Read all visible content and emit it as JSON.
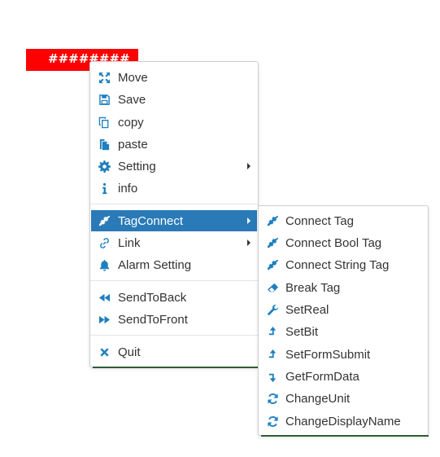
{
  "widget_label": "########",
  "colors": {
    "accent": "#2a7ab8",
    "icon": "#1e7fbf",
    "widget_bg": "#ff0000",
    "underline": "#2e5d34"
  },
  "main_menu": [
    {
      "label": "Move",
      "icon": "arrows-expand-icon"
    },
    {
      "label": "Save",
      "icon": "floppy-icon"
    },
    {
      "label": "copy",
      "icon": "copy-icon"
    },
    {
      "label": "paste",
      "icon": "paste-icon"
    },
    {
      "label": "Setting",
      "icon": "gear-icon",
      "submenu": true
    },
    {
      "label": "info",
      "icon": "info-icon"
    },
    {
      "label": "TagConnect",
      "icon": "plug-icon",
      "submenu": true,
      "active": true
    },
    {
      "label": "Link",
      "icon": "link-icon",
      "submenu": true
    },
    {
      "label": "Alarm Setting",
      "icon": "bell-icon"
    },
    {
      "label": "SendToBack",
      "icon": "backward-icon"
    },
    {
      "label": "SendToFront",
      "icon": "forward-icon"
    },
    {
      "label": "Quit",
      "icon": "close-icon"
    }
  ],
  "submenu": [
    {
      "label": "Connect Tag",
      "icon": "plug-icon"
    },
    {
      "label": "Connect Bool Tag",
      "icon": "plug-icon"
    },
    {
      "label": "Connect String Tag",
      "icon": "plug-icon"
    },
    {
      "label": "Break Tag",
      "icon": "eraser-icon"
    },
    {
      "label": "SetReal",
      "icon": "wrench-icon"
    },
    {
      "label": "SetBit",
      "icon": "arrow-up-icon"
    },
    {
      "label": "SetFormSubmit",
      "icon": "arrow-up-icon"
    },
    {
      "label": "GetFormData",
      "icon": "arrow-down-icon"
    },
    {
      "label": "ChangeUnit",
      "icon": "refresh-icon"
    },
    {
      "label": "ChangeDisplayName",
      "icon": "refresh-icon"
    }
  ]
}
